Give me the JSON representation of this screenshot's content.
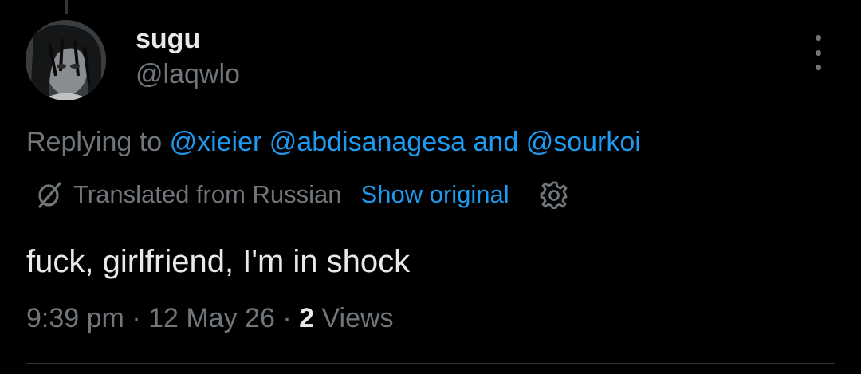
{
  "author": {
    "name": "sugu",
    "handle": "@laqwlo"
  },
  "reply": {
    "prefix": "Replying to",
    "mention_1": "@xieier",
    "mention_2": "@abdisanagesa",
    "conjunction": "and",
    "mention_3": "@sourkoi"
  },
  "translation": {
    "label": "Translated from Russian",
    "show_original": "Show original",
    "icon": "translate-icon",
    "settings_icon": "gear-icon"
  },
  "tweet": {
    "text": "fuck, girlfriend, I'm in shock"
  },
  "meta": {
    "time": "9:39 pm",
    "date": "12 May 26",
    "views_count": "2",
    "views_label": "Views",
    "separator": "·"
  },
  "colors": {
    "background": "#000000",
    "primary_text": "#e7e9ea",
    "secondary_text": "#71767b",
    "link": "#1d9bf0"
  }
}
